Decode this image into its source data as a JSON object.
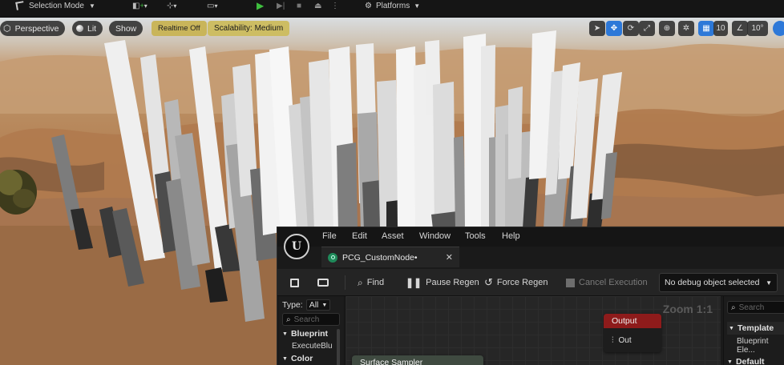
{
  "toolbar": {
    "mode_label": "Selection Mode",
    "platforms_label": "Platforms"
  },
  "viewport": {
    "perspective_label": "Perspective",
    "lit_label": "Lit",
    "show_label": "Show",
    "realtime_label": "Realtime Off",
    "scalability_label": "Scalability: Medium",
    "grid_snap_value": "10",
    "angle_snap_value": "10°"
  },
  "pcg_editor": {
    "menu": [
      "File",
      "Edit",
      "Asset",
      "Window",
      "Tools",
      "Help"
    ],
    "tab_title": "PCG_CustomNode•",
    "tools": {
      "find": "Find",
      "pause_regen": "Pause Regen",
      "force_regen": "Force Regen",
      "cancel_execution": "Cancel Execution"
    },
    "debug_object": "No debug object selected",
    "palette": {
      "type_label": "Type:",
      "type_value": "All",
      "search_placeholder": "Search",
      "sections": [
        "Blueprint",
        "Color"
      ],
      "blueprint_item": "ExecuteBlu"
    },
    "graph": {
      "zoom_label": "Zoom 1:1",
      "output_node_title": "Output",
      "output_pin": "Out",
      "sampler_node_title": "Surface Sampler"
    },
    "details": {
      "search_placeholder": "Search",
      "template_section": "Template",
      "template_item": "Blueprint Ele...",
      "default_section": "Default"
    }
  },
  "colors": {
    "accent_blue": "#2d78d8",
    "realtime_gold": "#c9b55a",
    "output_node_red": "#8e1b1b",
    "play_green": "#3fbf3f"
  }
}
